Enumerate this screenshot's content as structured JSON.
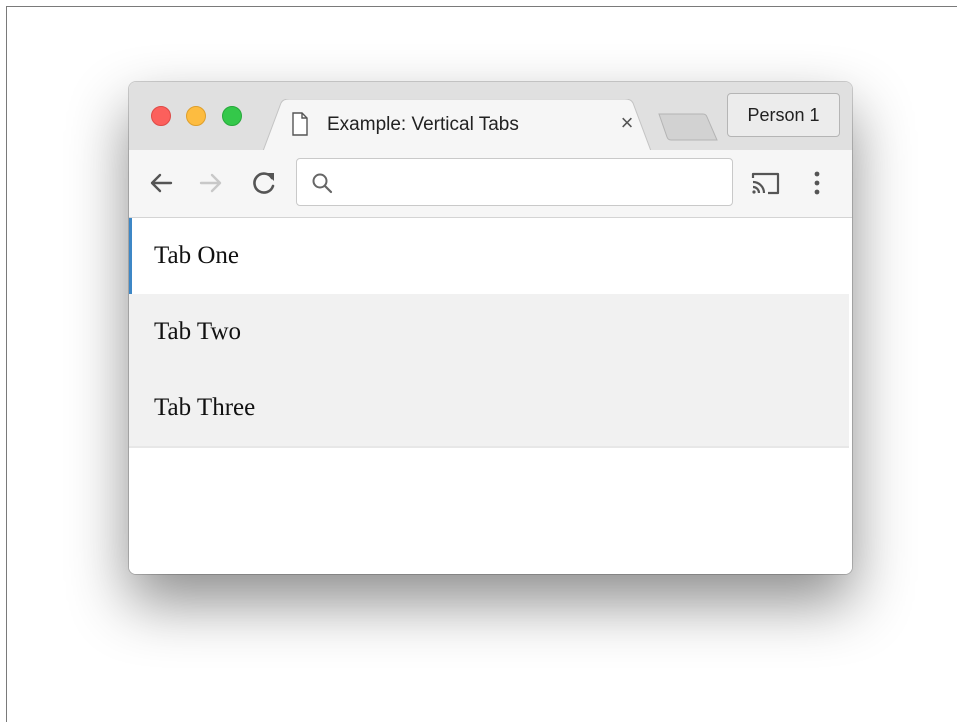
{
  "browser": {
    "tab": {
      "title": "Example: Vertical Tabs",
      "close_glyph": "×",
      "icon": "document-icon"
    },
    "new_tab_icon": "new-tab-icon",
    "profile_button": "Person 1",
    "toolbar": {
      "back_icon": "back-arrow-icon",
      "forward_icon": "forward-arrow-icon",
      "reload_icon": "reload-icon",
      "omnibox": {
        "value": "",
        "placeholder": ""
      },
      "cast_icon": "cast-icon",
      "menu_icon": "more-vertical-icon"
    },
    "traffic_lights": {
      "close": "#fc605c",
      "minimize": "#fdbc40",
      "maximize": "#34c84a"
    }
  },
  "page": {
    "vertical_tabs": [
      {
        "label": "Tab One",
        "active": true
      },
      {
        "label": "Tab Two",
        "active": false
      },
      {
        "label": "Tab Three",
        "active": false
      }
    ],
    "accent_color": "#3d87c6"
  }
}
